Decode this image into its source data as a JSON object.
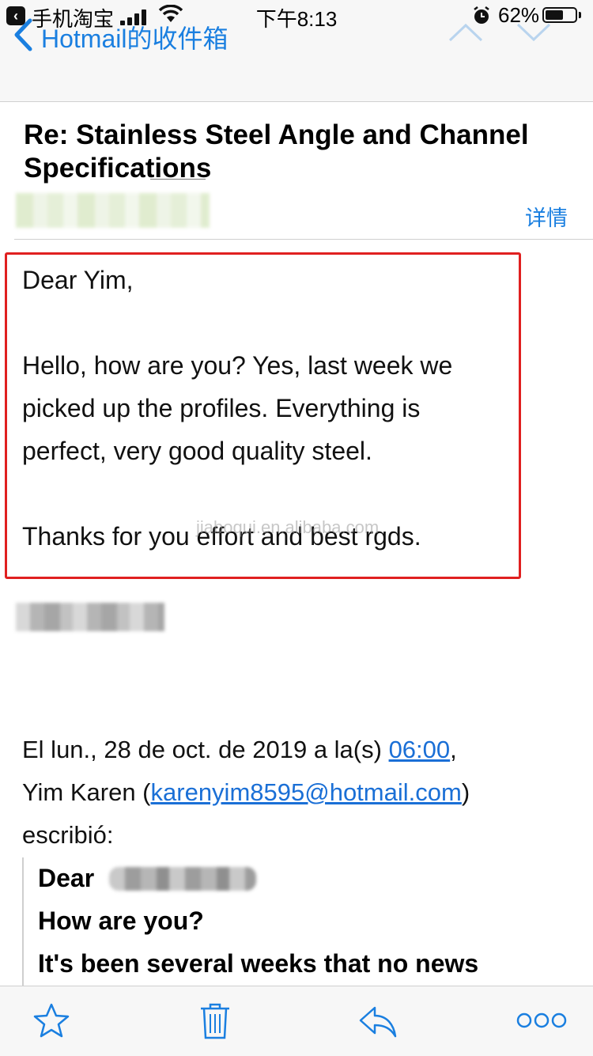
{
  "status_bar": {
    "back_app_label": "手机淘宝",
    "time": "下午8:13",
    "battery_percent": "62%",
    "battery_level": 0.62
  },
  "nav": {
    "back_label": "Hotmail的收件箱"
  },
  "email": {
    "subject": "Re: Stainless Steel Angle and Channel Specifications",
    "details_label": "详情",
    "body_lines": [
      "Dear Yim,",
      "Hello, how are you? Yes, last week we",
      "picked up the profiles. Everything is",
      "perfect, very good quality steel.",
      "Thanks for you effort and best rgds."
    ],
    "quote_intro": {
      "prefix": "El lun., 28 de oct. de 2019 a la(s) ",
      "time_link": "06:00",
      "comma": ",",
      "name_prefix": "Yim Karen (",
      "email_link": "karenyim8595@hotmail.com",
      "name_suffix": ")",
      "wrote": "escribió:"
    },
    "quoted_lines": [
      "Dear",
      "How are you?",
      "It's been several weeks that no news"
    ]
  },
  "watermark": "jiaboqui.en.alibaba.com",
  "colors": {
    "accent": "#1a7fe0",
    "highlight_border": "#e02020",
    "link": "#1a6fd6"
  },
  "toolbar": {
    "icons": [
      "star-icon",
      "trash-icon",
      "reply-icon",
      "more-icon"
    ]
  }
}
